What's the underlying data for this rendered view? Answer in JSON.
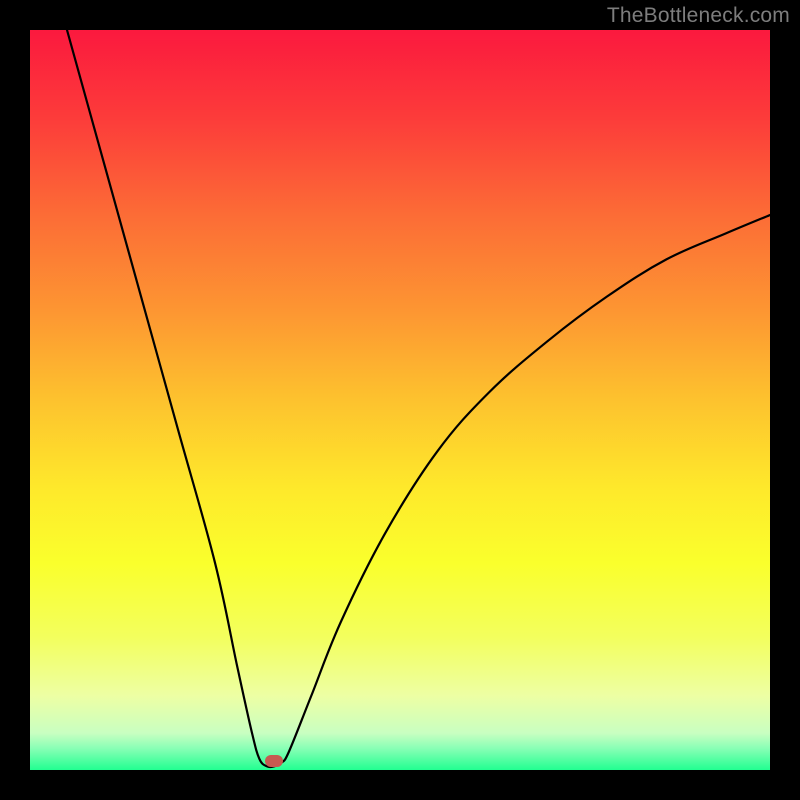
{
  "watermark": "TheBottleneck.com",
  "chart_data": {
    "type": "line",
    "title": "",
    "xlabel": "",
    "ylabel": "",
    "xlim": [
      0,
      100
    ],
    "ylim": [
      0,
      100
    ],
    "grid": false,
    "legend": false,
    "series": [
      {
        "name": "bottleneck-curve",
        "x": [
          5,
          10,
          15,
          20,
          25,
          28,
          30,
          31,
          32,
          33,
          34,
          35,
          38,
          42,
          48,
          55,
          62,
          70,
          78,
          86,
          94,
          100
        ],
        "y": [
          100,
          82,
          64,
          46,
          28,
          14,
          5,
          1.5,
          0.5,
          0.5,
          1.0,
          2.5,
          10,
          20,
          32,
          43,
          51,
          58,
          64,
          69,
          72.5,
          75
        ]
      }
    ],
    "marker": {
      "x": 33,
      "y": 1.2,
      "color": "#c65b51"
    },
    "background_gradient": {
      "stops": [
        {
          "pct": 0,
          "color": "#fb193e"
        },
        {
          "pct": 12,
          "color": "#fc3c3a"
        },
        {
          "pct": 25,
          "color": "#fc6c36"
        },
        {
          "pct": 38,
          "color": "#fd9632"
        },
        {
          "pct": 50,
          "color": "#fdc22e"
        },
        {
          "pct": 62,
          "color": "#fee92b"
        },
        {
          "pct": 72,
          "color": "#faff2c"
        },
        {
          "pct": 82,
          "color": "#f3ff5d"
        },
        {
          "pct": 90,
          "color": "#edffa4"
        },
        {
          "pct": 95,
          "color": "#c9ffc1"
        },
        {
          "pct": 97,
          "color": "#8bffb6"
        },
        {
          "pct": 100,
          "color": "#22ff91"
        }
      ]
    }
  }
}
